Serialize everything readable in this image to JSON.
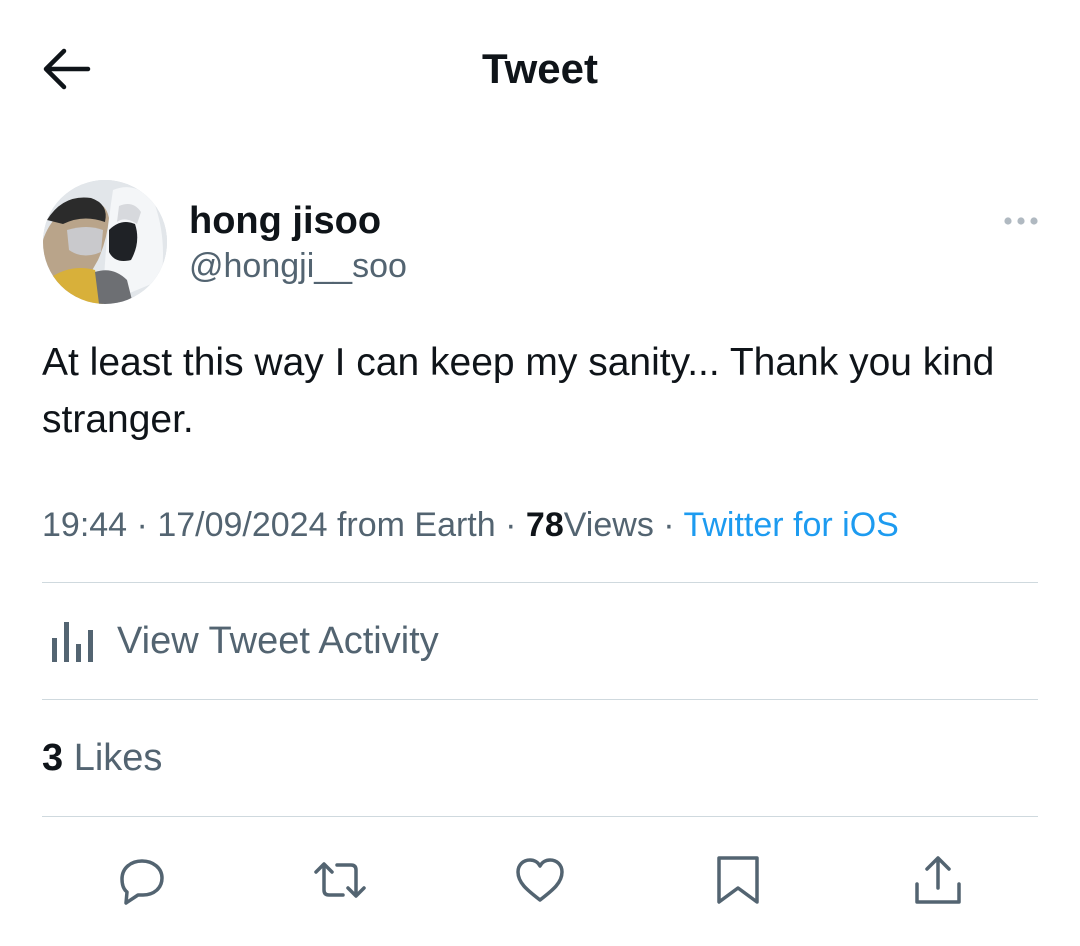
{
  "header": {
    "title": "Tweet",
    "back_icon": "arrow-left-icon"
  },
  "author": {
    "display_name": "hong jisoo",
    "handle": "@hongji__soo",
    "avatar": "profile-photo"
  },
  "tweet": {
    "text": "At least this way I can keep my sanity... Thank you kind stranger.",
    "time": "19:44",
    "date": "17/09/2024",
    "location": "from Earth",
    "views_count": "78",
    "views_label": "Views",
    "source": "Twitter for iOS",
    "separator": "·"
  },
  "activity": {
    "label": "View Tweet Activity",
    "icon": "bar-chart-icon"
  },
  "likes": {
    "count": "3",
    "label": "Likes"
  },
  "actions": [
    "reply-icon",
    "retweet-icon",
    "like-icon",
    "bookmark-icon",
    "share-icon"
  ],
  "colors": {
    "text": "#0f1419",
    "secondary": "#536471",
    "link": "#1d9bf0",
    "divider": "#cfd9de"
  }
}
